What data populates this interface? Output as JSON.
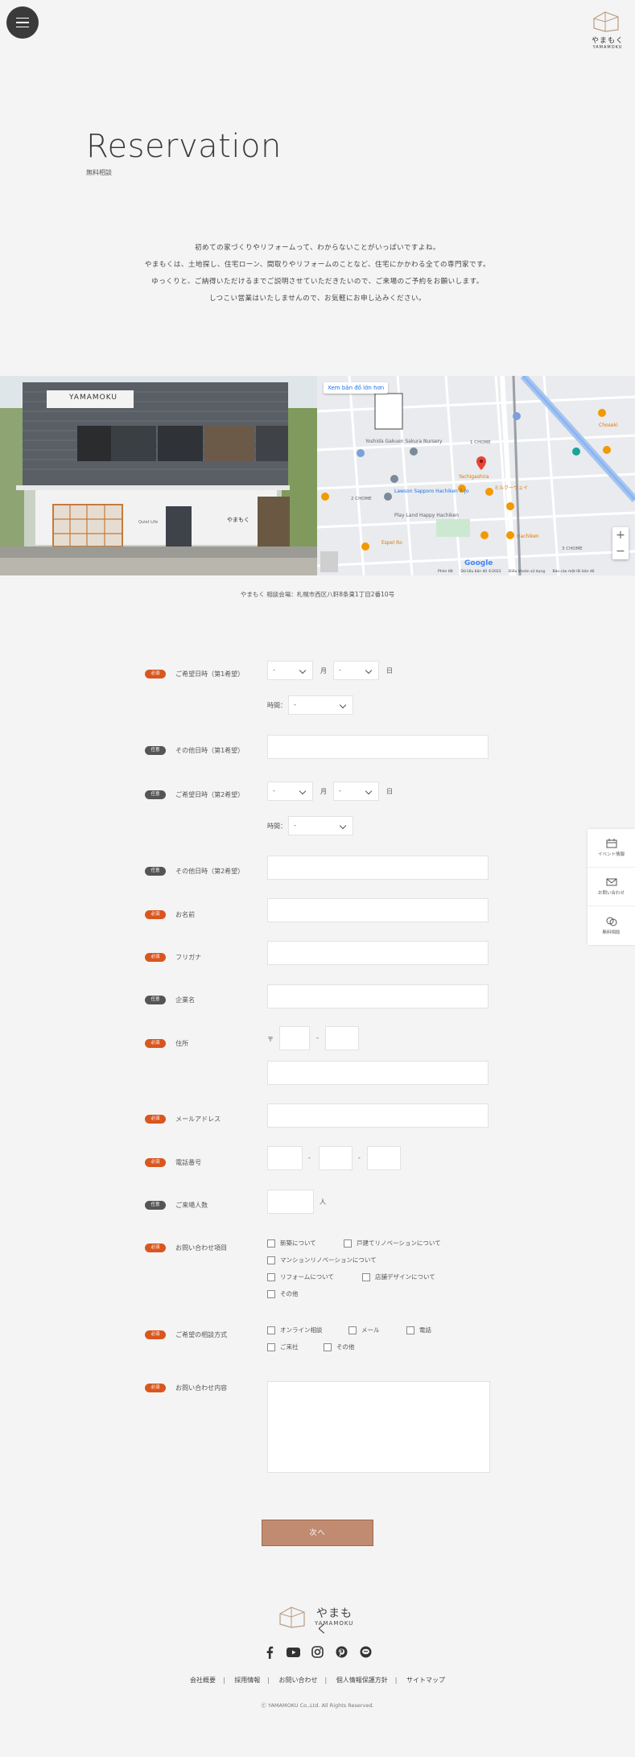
{
  "header": {
    "logo_jp": "やまもく",
    "logo_en": "YAMAMOKU"
  },
  "page": {
    "title": "Reservation",
    "subtitle": "無料相談"
  },
  "intro": [
    "初めての家づくりやリフォームって、わからないことがいっぱいですよね。",
    "やまもくは、土地探し、住宅ローン、間取りやリフォームのことなど、住宅にかかわる全ての専門家です。",
    "ゆっくりと、ご納得いただけるまでご説明させていただきたいので、ご来場のご予約をお願いします。",
    "しつこい営業はいたしませんので、お気軽にお申し込みください。"
  ],
  "photo": {
    "sign": "YAMAMOKU",
    "shop_sign": "やまもく",
    "window_text": "Quiet Life"
  },
  "map": {
    "link": "Xem bản đồ lớn hơn",
    "labels": [
      "Yoshida Gakuen Sakura Nursery",
      "Lawson Sapporo Hachiken 7-Jo",
      "Play Land Happy Hachiken",
      "Yachigashira",
      "ミルクーウェイ",
      "Hachiken",
      "Choseki",
      "Espel Ito",
      "1 CHOME",
      "2 CHOME",
      "3 CHOME"
    ],
    "attr": [
      "Phím tắt",
      "Dữ liệu bản đồ ©2023",
      "Điều khoản sử dụng",
      "Báo cáo một lỗi bản đồ"
    ],
    "google": "Google",
    "zoom_in": "+",
    "zoom_out": "−"
  },
  "address": "やまもく 相談会場：札幌市西区八軒8条東1丁目2番10号",
  "badges": {
    "required": "必須",
    "optional": "任意"
  },
  "form": {
    "date1_label": "ご希望日時（第1希望）",
    "other1_label": "その他日時（第1希望）",
    "date2_label": "ご希望日時（第2希望）",
    "other2_label": "その他日時（第2希望）",
    "name_label": "お名前",
    "kana_label": "フリガナ",
    "company_label": "企業名",
    "address_label": "住所",
    "email_label": "メールアドレス",
    "phone_label": "電話番号",
    "count_label": "ご来場人数",
    "topic_label": "お問い合わせ項目",
    "method_label": "ご希望の相談方式",
    "content_label": "お問い合わせ内容",
    "select_placeholder": "-",
    "month": "月",
    "day": "日",
    "time": "時間：",
    "postal_mark": "〒",
    "hyphen": "-",
    "people": "人",
    "topics": [
      "新築について",
      "戸建てリノベーションについて",
      "マンションリノベーションについて",
      "リフォームについて",
      "店舗デザインについて",
      "その他"
    ],
    "methods": [
      "オンライン相談",
      "メール",
      "電話",
      "ご来社",
      "その他"
    ],
    "submit": "次へ"
  },
  "side_menu": [
    "イベント情報",
    "お問い合わせ",
    "無料相談"
  ],
  "footer": {
    "logo_jp": "やまもく",
    "logo_en": "YAMAMOKU",
    "nav": [
      "会社概要",
      "採用情報",
      "お問い合わせ",
      "個人情報保護方針",
      "サイトマップ"
    ],
    "copyright": "Ⓒ YAMAMOKU Co.,Ltd. All Rights Reserved."
  }
}
